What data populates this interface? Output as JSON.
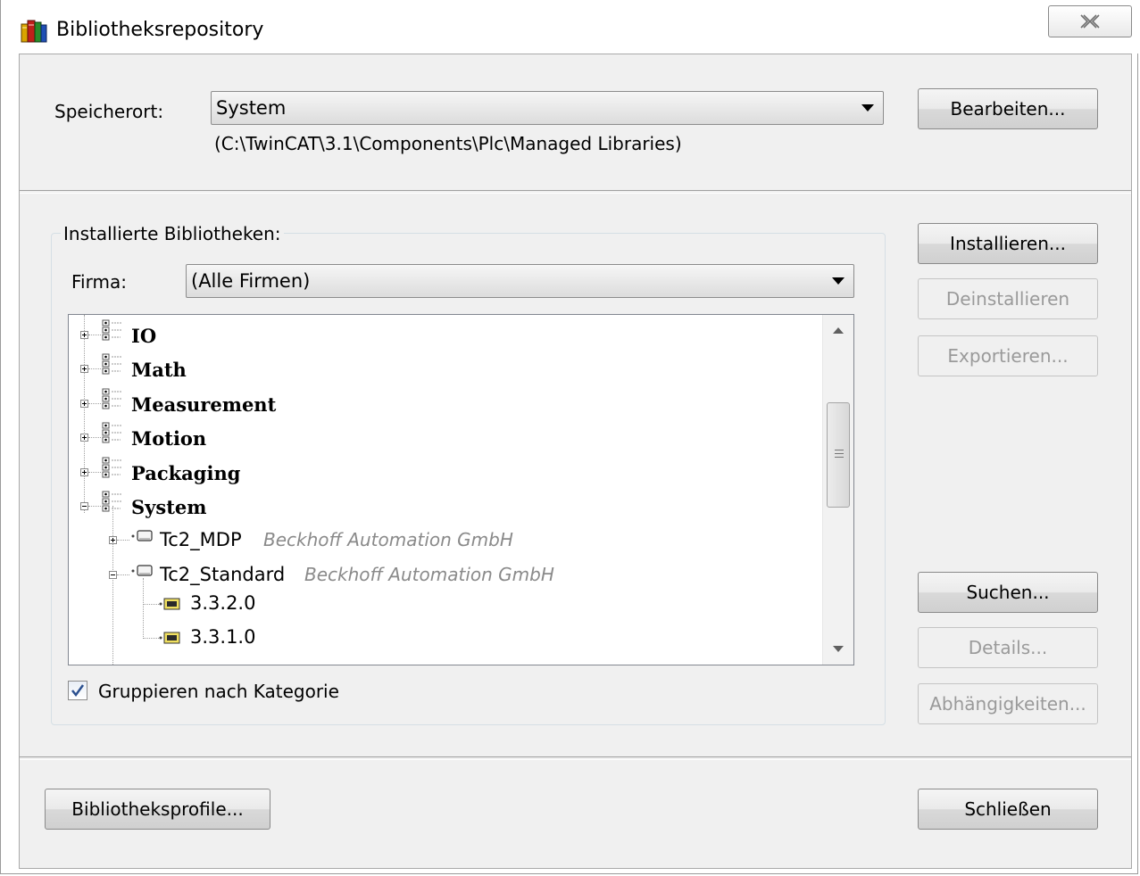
{
  "window": {
    "title": "Bibliotheksrepository",
    "close_icon": "close-icon"
  },
  "location": {
    "label": "Speicherort:",
    "selected": "System",
    "path": "(C:\\TwinCAT\\3.1\\Components\\Plc\\Managed Libraries)",
    "edit_button": "Bearbeiten..."
  },
  "installed": {
    "group_title": "Installierte Bibliotheken:",
    "company_label": "Firma:",
    "company_selected": "(Alle Firmen)",
    "categories": [
      "IO",
      "Math",
      "Measurement",
      "Motion",
      "Packaging",
      "System"
    ],
    "libraries": [
      {
        "name": "Tc2_MDP",
        "company": "Beckhoff Automation GmbH",
        "expanded": false
      },
      {
        "name": "Tc2_Standard",
        "company": "Beckhoff Automation GmbH",
        "expanded": true
      }
    ],
    "versions": [
      "3.3.2.0",
      "3.3.1.0"
    ],
    "group_checkbox_label": "Gruppieren nach Kategorie",
    "group_checkbox_checked": true
  },
  "buttons": {
    "install": "Installieren...",
    "uninstall": "Deinstallieren",
    "export": "Exportieren...",
    "search": "Suchen...",
    "details": "Details...",
    "dependencies": "Abhängigkeiten...",
    "profiles": "Bibliotheksprofile...",
    "close": "Schließen"
  }
}
